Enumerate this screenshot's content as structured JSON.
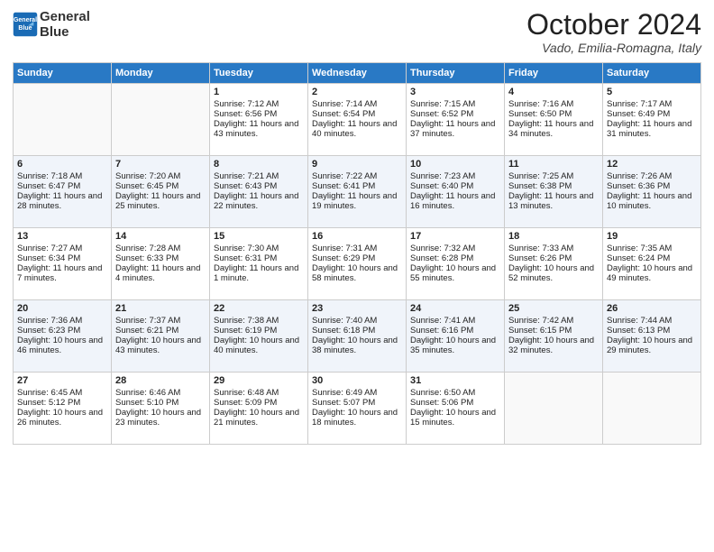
{
  "header": {
    "logo_line1": "General",
    "logo_line2": "Blue",
    "month": "October 2024",
    "location": "Vado, Emilia-Romagna, Italy"
  },
  "days_of_week": [
    "Sunday",
    "Monday",
    "Tuesday",
    "Wednesday",
    "Thursday",
    "Friday",
    "Saturday"
  ],
  "weeks": [
    [
      {
        "day": "",
        "sunrise": "",
        "sunset": "",
        "daylight": ""
      },
      {
        "day": "",
        "sunrise": "",
        "sunset": "",
        "daylight": ""
      },
      {
        "day": "1",
        "sunrise": "Sunrise: 7:12 AM",
        "sunset": "Sunset: 6:56 PM",
        "daylight": "Daylight: 11 hours and 43 minutes."
      },
      {
        "day": "2",
        "sunrise": "Sunrise: 7:14 AM",
        "sunset": "Sunset: 6:54 PM",
        "daylight": "Daylight: 11 hours and 40 minutes."
      },
      {
        "day": "3",
        "sunrise": "Sunrise: 7:15 AM",
        "sunset": "Sunset: 6:52 PM",
        "daylight": "Daylight: 11 hours and 37 minutes."
      },
      {
        "day": "4",
        "sunrise": "Sunrise: 7:16 AM",
        "sunset": "Sunset: 6:50 PM",
        "daylight": "Daylight: 11 hours and 34 minutes."
      },
      {
        "day": "5",
        "sunrise": "Sunrise: 7:17 AM",
        "sunset": "Sunset: 6:49 PM",
        "daylight": "Daylight: 11 hours and 31 minutes."
      }
    ],
    [
      {
        "day": "6",
        "sunrise": "Sunrise: 7:18 AM",
        "sunset": "Sunset: 6:47 PM",
        "daylight": "Daylight: 11 hours and 28 minutes."
      },
      {
        "day": "7",
        "sunrise": "Sunrise: 7:20 AM",
        "sunset": "Sunset: 6:45 PM",
        "daylight": "Daylight: 11 hours and 25 minutes."
      },
      {
        "day": "8",
        "sunrise": "Sunrise: 7:21 AM",
        "sunset": "Sunset: 6:43 PM",
        "daylight": "Daylight: 11 hours and 22 minutes."
      },
      {
        "day": "9",
        "sunrise": "Sunrise: 7:22 AM",
        "sunset": "Sunset: 6:41 PM",
        "daylight": "Daylight: 11 hours and 19 minutes."
      },
      {
        "day": "10",
        "sunrise": "Sunrise: 7:23 AM",
        "sunset": "Sunset: 6:40 PM",
        "daylight": "Daylight: 11 hours and 16 minutes."
      },
      {
        "day": "11",
        "sunrise": "Sunrise: 7:25 AM",
        "sunset": "Sunset: 6:38 PM",
        "daylight": "Daylight: 11 hours and 13 minutes."
      },
      {
        "day": "12",
        "sunrise": "Sunrise: 7:26 AM",
        "sunset": "Sunset: 6:36 PM",
        "daylight": "Daylight: 11 hours and 10 minutes."
      }
    ],
    [
      {
        "day": "13",
        "sunrise": "Sunrise: 7:27 AM",
        "sunset": "Sunset: 6:34 PM",
        "daylight": "Daylight: 11 hours and 7 minutes."
      },
      {
        "day": "14",
        "sunrise": "Sunrise: 7:28 AM",
        "sunset": "Sunset: 6:33 PM",
        "daylight": "Daylight: 11 hours and 4 minutes."
      },
      {
        "day": "15",
        "sunrise": "Sunrise: 7:30 AM",
        "sunset": "Sunset: 6:31 PM",
        "daylight": "Daylight: 11 hours and 1 minute."
      },
      {
        "day": "16",
        "sunrise": "Sunrise: 7:31 AM",
        "sunset": "Sunset: 6:29 PM",
        "daylight": "Daylight: 10 hours and 58 minutes."
      },
      {
        "day": "17",
        "sunrise": "Sunrise: 7:32 AM",
        "sunset": "Sunset: 6:28 PM",
        "daylight": "Daylight: 10 hours and 55 minutes."
      },
      {
        "day": "18",
        "sunrise": "Sunrise: 7:33 AM",
        "sunset": "Sunset: 6:26 PM",
        "daylight": "Daylight: 10 hours and 52 minutes."
      },
      {
        "day": "19",
        "sunrise": "Sunrise: 7:35 AM",
        "sunset": "Sunset: 6:24 PM",
        "daylight": "Daylight: 10 hours and 49 minutes."
      }
    ],
    [
      {
        "day": "20",
        "sunrise": "Sunrise: 7:36 AM",
        "sunset": "Sunset: 6:23 PM",
        "daylight": "Daylight: 10 hours and 46 minutes."
      },
      {
        "day": "21",
        "sunrise": "Sunrise: 7:37 AM",
        "sunset": "Sunset: 6:21 PM",
        "daylight": "Daylight: 10 hours and 43 minutes."
      },
      {
        "day": "22",
        "sunrise": "Sunrise: 7:38 AM",
        "sunset": "Sunset: 6:19 PM",
        "daylight": "Daylight: 10 hours and 40 minutes."
      },
      {
        "day": "23",
        "sunrise": "Sunrise: 7:40 AM",
        "sunset": "Sunset: 6:18 PM",
        "daylight": "Daylight: 10 hours and 38 minutes."
      },
      {
        "day": "24",
        "sunrise": "Sunrise: 7:41 AM",
        "sunset": "Sunset: 6:16 PM",
        "daylight": "Daylight: 10 hours and 35 minutes."
      },
      {
        "day": "25",
        "sunrise": "Sunrise: 7:42 AM",
        "sunset": "Sunset: 6:15 PM",
        "daylight": "Daylight: 10 hours and 32 minutes."
      },
      {
        "day": "26",
        "sunrise": "Sunrise: 7:44 AM",
        "sunset": "Sunset: 6:13 PM",
        "daylight": "Daylight: 10 hours and 29 minutes."
      }
    ],
    [
      {
        "day": "27",
        "sunrise": "Sunrise: 6:45 AM",
        "sunset": "Sunset: 5:12 PM",
        "daylight": "Daylight: 10 hours and 26 minutes."
      },
      {
        "day": "28",
        "sunrise": "Sunrise: 6:46 AM",
        "sunset": "Sunset: 5:10 PM",
        "daylight": "Daylight: 10 hours and 23 minutes."
      },
      {
        "day": "29",
        "sunrise": "Sunrise: 6:48 AM",
        "sunset": "Sunset: 5:09 PM",
        "daylight": "Daylight: 10 hours and 21 minutes."
      },
      {
        "day": "30",
        "sunrise": "Sunrise: 6:49 AM",
        "sunset": "Sunset: 5:07 PM",
        "daylight": "Daylight: 10 hours and 18 minutes."
      },
      {
        "day": "31",
        "sunrise": "Sunrise: 6:50 AM",
        "sunset": "Sunset: 5:06 PM",
        "daylight": "Daylight: 10 hours and 15 minutes."
      },
      {
        "day": "",
        "sunrise": "",
        "sunset": "",
        "daylight": ""
      },
      {
        "day": "",
        "sunrise": "",
        "sunset": "",
        "daylight": ""
      }
    ]
  ]
}
